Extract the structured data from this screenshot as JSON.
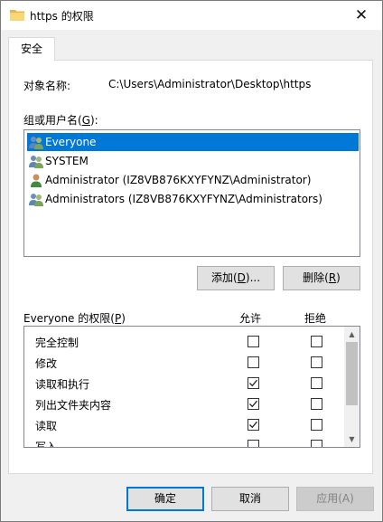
{
  "window": {
    "title": "https 的权限",
    "close_glyph": "✕"
  },
  "tabs": [
    {
      "label": "安全",
      "selected": true
    }
  ],
  "object": {
    "label": "对象名称:",
    "value": "C:\\Users\\Administrator\\Desktop\\https"
  },
  "groups": {
    "label_pre": "组或用户名(",
    "label_key": "G",
    "label_post": "):",
    "items": [
      {
        "name": "Everyone",
        "icon": "group-users-icon",
        "selected": true
      },
      {
        "name": "SYSTEM",
        "icon": "group-users-icon",
        "selected": false
      },
      {
        "name": "Administrator (IZ8VB876KXYFYNZ\\Administrator)",
        "icon": "user-icon",
        "selected": false
      },
      {
        "name": "Administrators (IZ8VB876KXYFYNZ\\Administrators)",
        "icon": "group-users-icon",
        "selected": false
      }
    ]
  },
  "buttons": {
    "add": {
      "pre": "添加(",
      "key": "D",
      "post": ")..."
    },
    "remove": {
      "pre": "删除(",
      "key": "R",
      "post": ")"
    },
    "ok": "确定",
    "cancel": "取消",
    "apply": "应用(A)"
  },
  "permissions": {
    "label_pre": "Everyone 的权限(",
    "label_key": "P",
    "label_post": ")",
    "allow_header": "允许",
    "deny_header": "拒绝",
    "rows": [
      {
        "name": "完全控制",
        "allow": false,
        "deny": false
      },
      {
        "name": "修改",
        "allow": false,
        "deny": false
      },
      {
        "name": "读取和执行",
        "allow": true,
        "deny": false
      },
      {
        "name": "列出文件夹内容",
        "allow": true,
        "deny": false
      },
      {
        "name": "读取",
        "allow": true,
        "deny": false
      },
      {
        "name": "写入",
        "allow": false,
        "deny": false
      }
    ]
  },
  "colors": {
    "accent": "#0078d7",
    "dialog_bg": "#f0f0f0",
    "panel_bg": "#ffffff"
  }
}
